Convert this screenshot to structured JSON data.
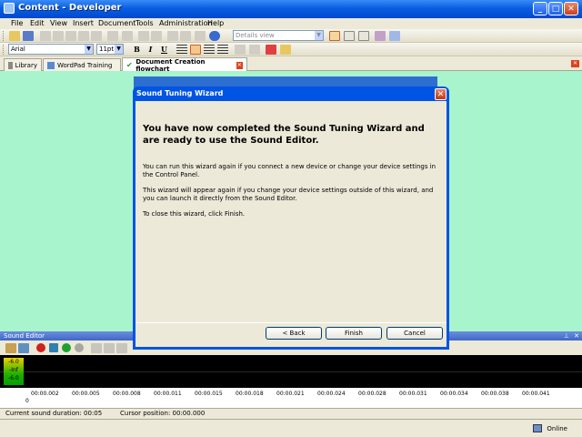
{
  "window": {
    "title": "Content - Developer",
    "minimize": "_",
    "maximize": "□",
    "close": "✕"
  },
  "menu": [
    "File",
    "Edit",
    "View",
    "Insert",
    "Document",
    "Tools",
    "Administration",
    "Help"
  ],
  "toolbar": {
    "view_select": "Details view"
  },
  "format": {
    "font": "Arial",
    "size": "11pt",
    "bold": "B",
    "italic": "I",
    "underline": "U"
  },
  "tabs": [
    {
      "label": "Library"
    },
    {
      "label": "WordPad Training"
    },
    {
      "label": "Document Creation flowchart",
      "active": true
    }
  ],
  "dialog": {
    "title": "Sound Tuning Wizard",
    "heading": "You have now completed the Sound Tuning Wizard and are ready to use the Sound Editor.",
    "paragraphs": [
      "You can run this wizard again if you connect a new device or change your device settings in the Control Panel.",
      "This wizard will appear again if you change your device settings outside of this wizard, and you can launch it directly from the Sound Editor.",
      "To close this wizard, click Finish."
    ],
    "buttons": {
      "back": "< Back",
      "finish": "Finish",
      "cancel": "Cancel"
    }
  },
  "sound_editor": {
    "title": "Sound Editor",
    "meter": [
      "-6.0",
      "-Inf",
      "-6.0"
    ],
    "timeline": [
      "00:00.002",
      "00:00.005",
      "00:00.008",
      "00:00.011",
      "00:00.015",
      "00:00.018",
      "00:00.021",
      "00:00.024",
      "00:00.028",
      "00:00.031",
      "00:00.034",
      "00:00.038",
      "00:00.041"
    ],
    "marker": "0",
    "status": {
      "duration": "Current sound duration: 00:05",
      "cursor": "Cursor position: 00:00.000"
    }
  },
  "statusbar": {
    "online": "Online"
  }
}
